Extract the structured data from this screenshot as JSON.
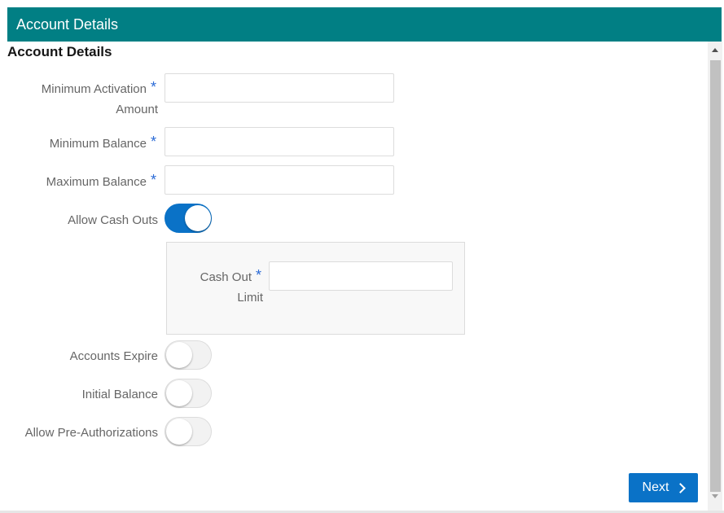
{
  "header": {
    "title": "Account Details"
  },
  "section": {
    "title": "Account Details"
  },
  "fields": {
    "min_activation": {
      "label_line1": "Minimum Activation",
      "label_line2": "Amount",
      "required": "*",
      "value": ""
    },
    "min_balance": {
      "label": "Minimum Balance",
      "required": "*",
      "value": ""
    },
    "max_balance": {
      "label": "Maximum Balance",
      "required": "*",
      "value": ""
    },
    "cash_out_limit": {
      "label_line1": "Cash Out",
      "label_line2": "Limit",
      "required": "*",
      "value": ""
    }
  },
  "toggles": {
    "allow_cash_outs": {
      "label": "Allow Cash Outs",
      "on": true
    },
    "accounts_expire": {
      "label": "Accounts Expire",
      "on": false
    },
    "initial_balance": {
      "label": "Initial Balance",
      "on": false
    },
    "allow_pre_auth": {
      "label": "Allow Pre-Authorizations",
      "on": false
    }
  },
  "buttons": {
    "next_label": "Next"
  },
  "colors": {
    "header": "#017f84",
    "accent": "#0a72c7",
    "required": "#2b6bd6"
  },
  "icons": {
    "next": "chevron-right-icon",
    "scroll_up": "arrow-up-icon",
    "scroll_down": "arrow-down-icon"
  }
}
